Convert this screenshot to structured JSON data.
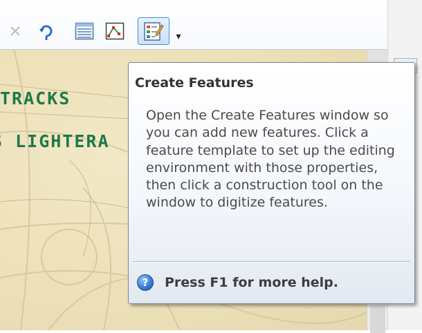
{
  "toolbar": {
    "buttons": [
      {
        "icon": "delete-vertex-icon"
      },
      {
        "icon": "rotate-icon"
      },
      {
        "icon": "attributes-table-icon"
      },
      {
        "icon": "sketch-properties-icon"
      },
      {
        "icon": "create-features-icon",
        "state": "active"
      }
    ],
    "dropdown_glyph": "▾"
  },
  "map": {
    "labels": [
      "TRACKS",
      "S LIGHTERA"
    ],
    "label_color": "#1c7a4a",
    "background_color": "#ece0b8"
  },
  "tooltip": {
    "title": "Create Features",
    "body": "Open the Create Features window so you can add new features. Click a feature template to set up the editing environment with those properties, then click a construction tool on the window to digitize features.",
    "help_glyph": "?",
    "footer": "Press F1 for more help."
  },
  "colors": {
    "accent": "#3f8fd8",
    "help_icon": "#2c74cf"
  }
}
